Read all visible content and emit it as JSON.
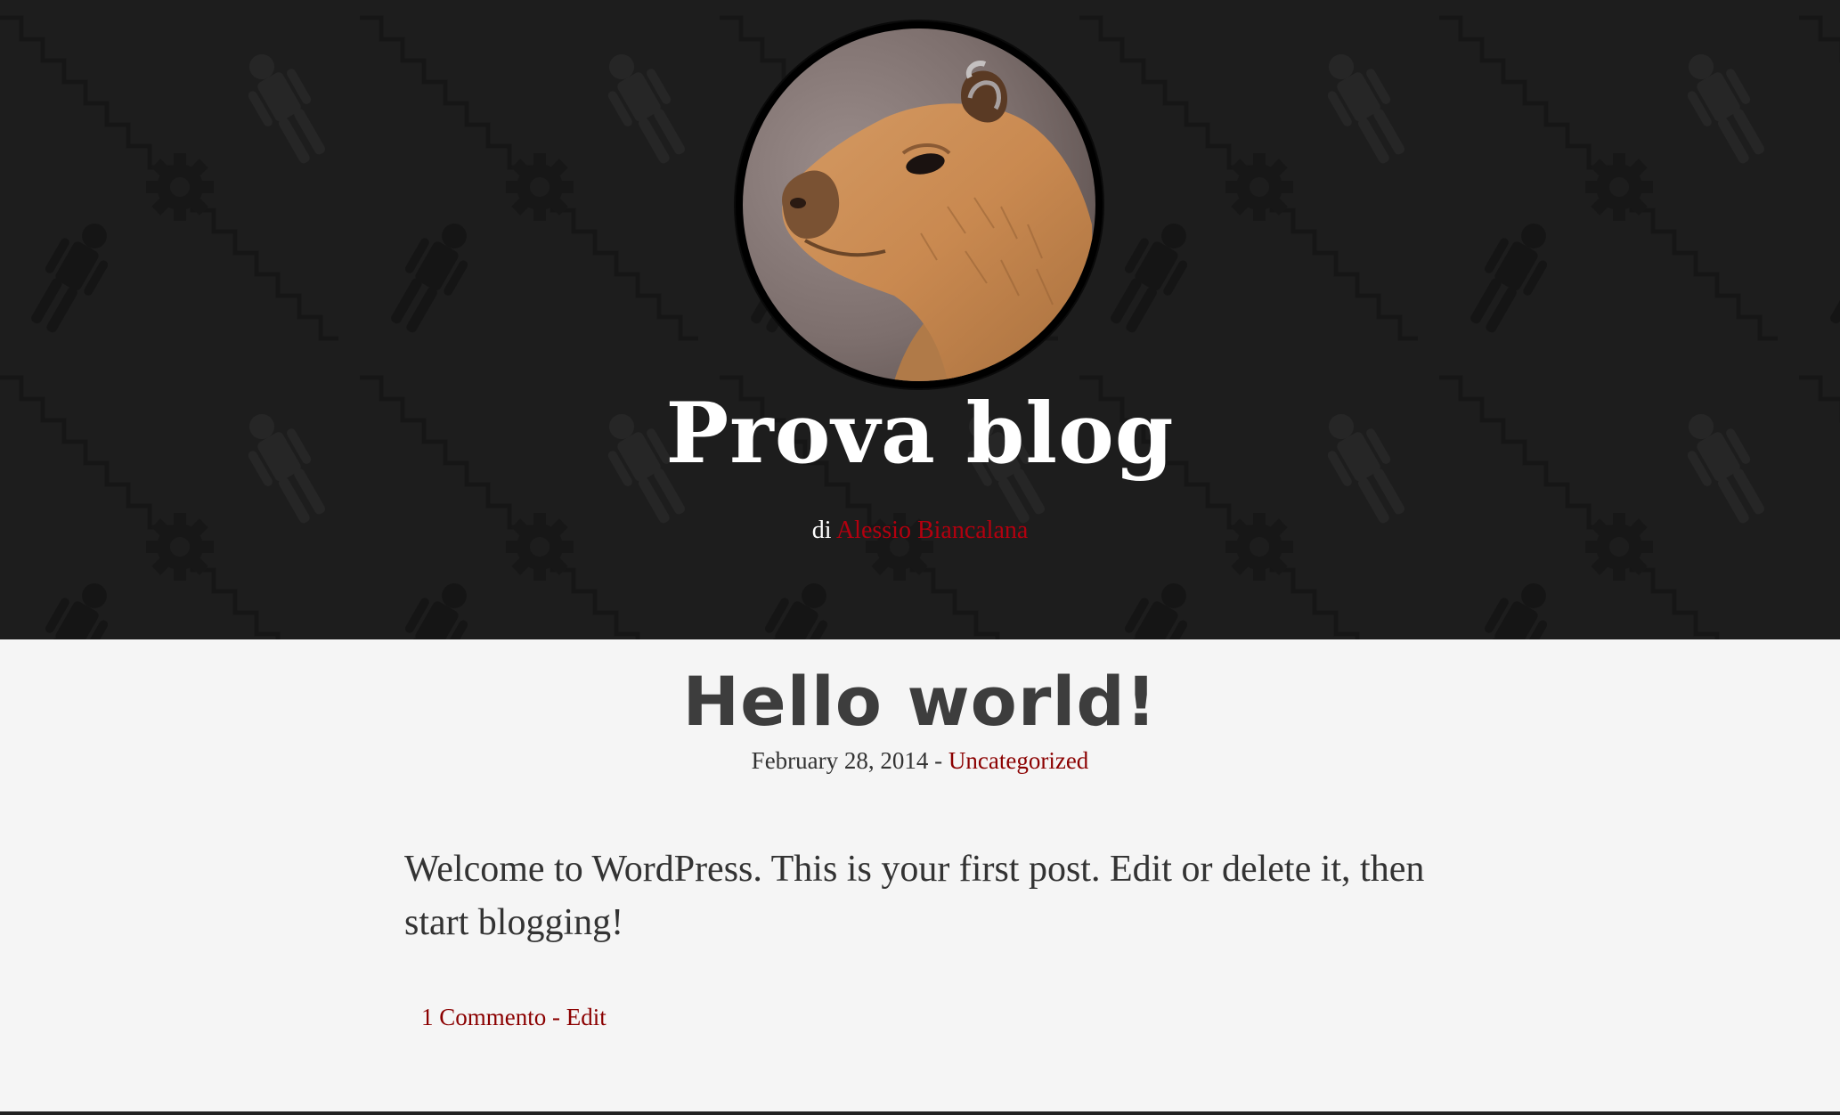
{
  "header": {
    "site_title": "Prova blog",
    "byline_prefix": "di",
    "author_name": "Alessio Biancalana",
    "avatar_icon": "capybara-avatar",
    "background_pattern_icons": [
      "gear-icon",
      "figure-icon",
      "zigzag-line"
    ]
  },
  "post": {
    "title": "Hello world!",
    "date": "February 28, 2014",
    "meta_separator": "-",
    "category": "Uncategorized",
    "body": "Welcome to WordPress. This is your first post. Edit or delete it, then start blogging!",
    "comments_link": "1 Commento",
    "footer_separator": "-",
    "edit_link": "Edit"
  },
  "colors": {
    "header_background": "#1d1d1d",
    "content_background": "#f5f5f5",
    "accent_link": "#8b0000",
    "author_link": "#b3000f",
    "title_text": "#3d3d3d"
  }
}
